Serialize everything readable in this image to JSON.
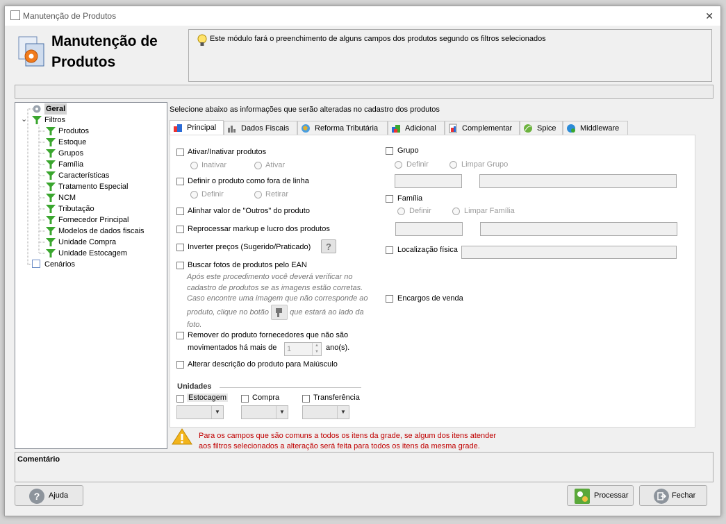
{
  "window": {
    "title": "Manutenção de Produtos",
    "close_glyph": "✕"
  },
  "header": {
    "title_line1": "Manutenção de",
    "title_line2": "Produtos",
    "info_text": "Este módulo fará o preenchimento de alguns campos dos produtos segundo os filtros selecionados"
  },
  "tree": {
    "root": "Geral",
    "filters": "Filtros",
    "expander_glyph": "⌄",
    "items": [
      "Produtos",
      "Estoque",
      "Grupos",
      "Família",
      "Características",
      "Tratamento Especial",
      "NCM",
      "Tributação",
      "Fornecedor Principal",
      "Modelos de dados fiscais",
      "Unidade Compra",
      "Unidade Estocagem"
    ],
    "scenarios": "Cenários"
  },
  "main": {
    "caption": "Selecione abaixo as informações que serão alteradas no cadastro dos produtos",
    "tabs": [
      "Principal",
      "Dados Fiscais",
      "Reforma Tributária",
      "Adicional",
      "Complementar",
      "Spice",
      "Middleware"
    ]
  },
  "principal": {
    "ativar_inativar": "Ativar/Inativar produtos",
    "inativar": "Inativar",
    "ativar": "Ativar",
    "fora_linha": "Definir o produto como fora de linha",
    "definir": "Definir",
    "retirar": "Retirar",
    "alinhar_outros": "Alinhar valor de \"Outros\" do produto",
    "reprocessar": "Reprocessar markup e lucro dos produtos",
    "inverter": "Inverter preços (Sugerido/Praticado)",
    "help_glyph": "?",
    "buscar_fotos": "Buscar fotos de produtos pelo EAN",
    "note_lines": [
      "Após este procedimento você deverá verificar no",
      "cadastro de produtos se as imagens estão corretas.",
      "Caso encontre uma imagem que não corresponde ao",
      "produto, clique no botão",
      "que estará ao lado da",
      "foto."
    ],
    "remover_line1": "Remover do produto fornecedores que não são",
    "remover_line2": "movimentados há mais de",
    "remover_value": "1",
    "remover_unit": "ano(s).",
    "maiusculo": "Alterar descrição do produto para Maiúsculo",
    "unidades_title": "Unidades",
    "estocagem": "Estocagem",
    "compra": "Compra",
    "transferencia": "Transferência",
    "grupo": "Grupo",
    "grupo_definir": "Definir",
    "limpar_grupo": "Limpar Grupo",
    "familia": "Família",
    "familia_definir": "Definir",
    "limpar_familia": "Limpar Família",
    "localizacao": "Localização física",
    "encargos": "Encargos de venda"
  },
  "warning": {
    "line1": "Para os campos que são comuns a todos os itens da grade, se algum dos itens atender",
    "line2": "aos filtros selecionados a alteração será feita para todos os itens da mesma grade."
  },
  "comment": {
    "label": "Comentário"
  },
  "buttons": {
    "help": "Ajuda",
    "process": "Processar",
    "close": "Fechar"
  },
  "colors": {
    "funnel": "#3aa62e",
    "warning_text": "#c00000",
    "warning_icon": "#f2b41b"
  }
}
